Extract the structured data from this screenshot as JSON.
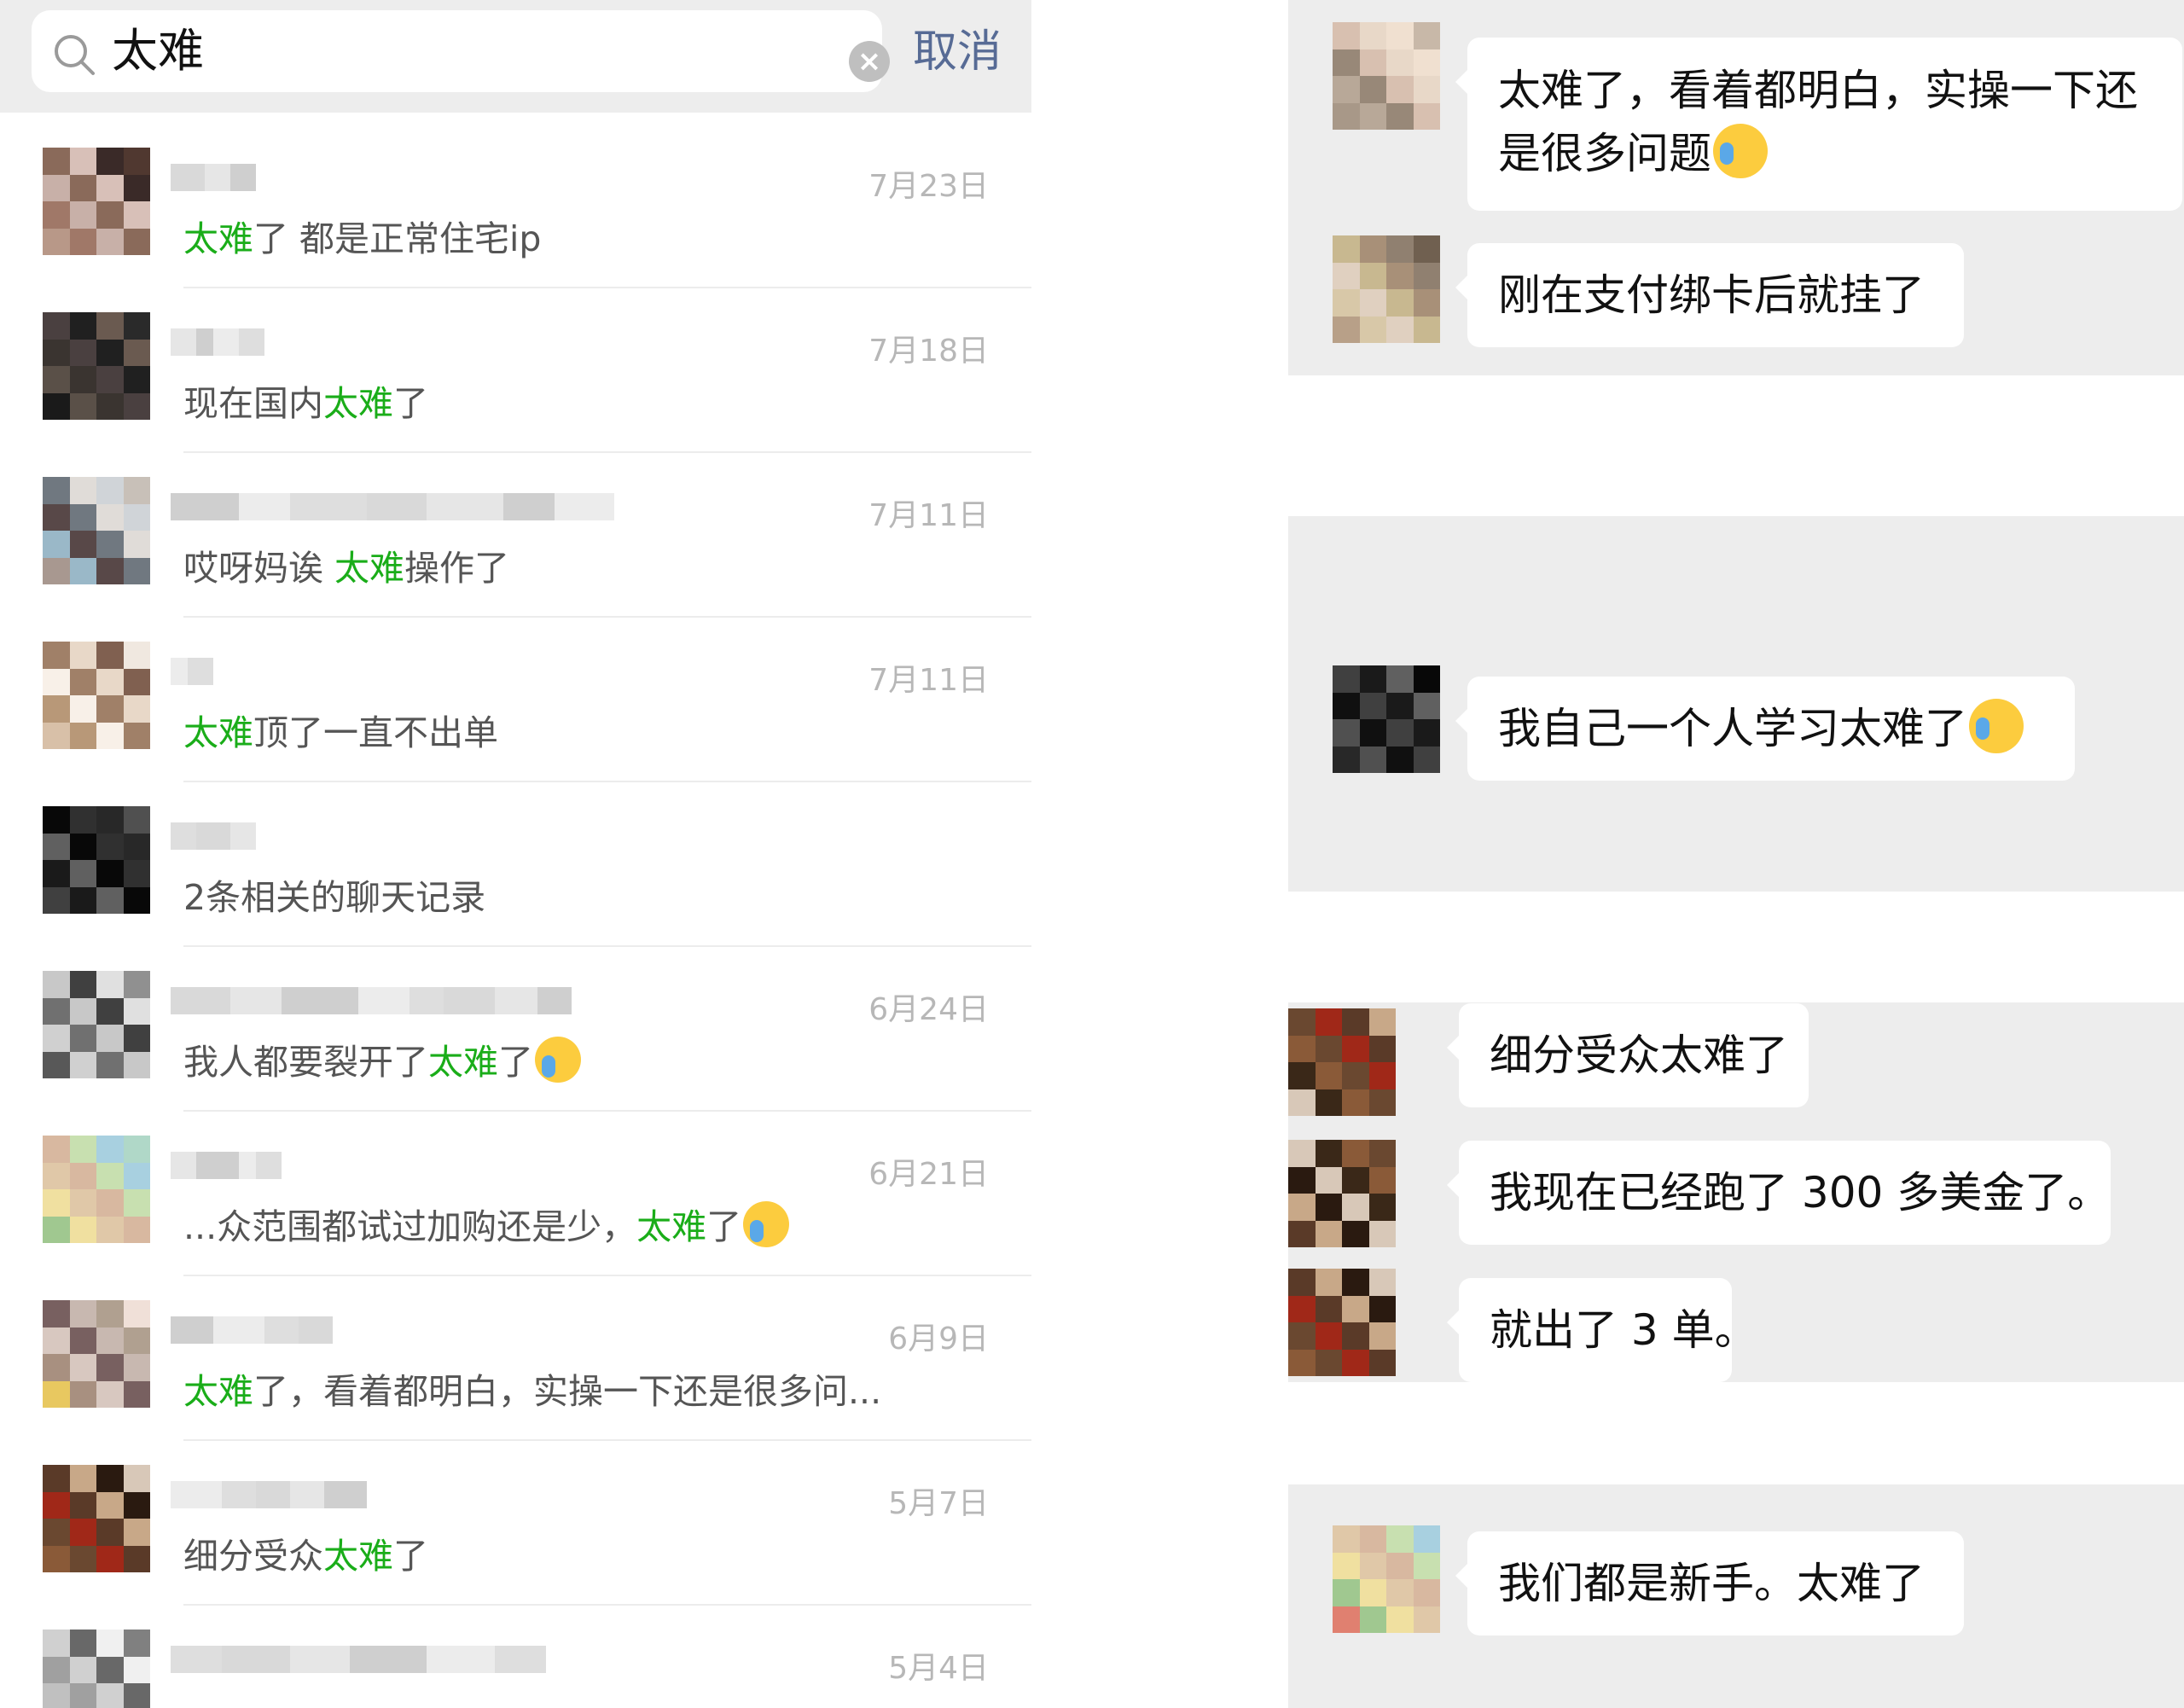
{
  "search": {
    "query": "太难",
    "cancel_label": "取消",
    "clear_icon": "×"
  },
  "results": [
    {
      "date": "7月23日",
      "pre": "",
      "hl": "太难",
      "post": "了 都是正常住宅ip",
      "emoji": false
    },
    {
      "date": "7月18日",
      "pre": "现在国内",
      "hl": "太难",
      "post": "了",
      "emoji": false
    },
    {
      "date": "7月11日",
      "pre": "哎呀妈诶 ",
      "hl": "太难",
      "post": "操作了",
      "emoji": false
    },
    {
      "date": "7月11日",
      "pre": "",
      "hl": "太难",
      "post": "顶了一直不出单",
      "emoji": false
    },
    {
      "date": "",
      "pre": "2条相关的聊天记录",
      "hl": "",
      "post": "",
      "emoji": false
    },
    {
      "date": "6月24日",
      "pre": "我人都要裂开了",
      "hl": "太难",
      "post": "了",
      "emoji": true
    },
    {
      "date": "6月21日",
      "pre": "...众范围都试过加购还是少，",
      "hl": "太难",
      "post": "了",
      "emoji": true
    },
    {
      "date": "6月9日",
      "pre": "",
      "hl": "太难",
      "post": "了，看着都明白，实操一下还是很多问...",
      "emoji": false
    },
    {
      "date": "5月7日",
      "pre": "细分受众",
      "hl": "太难",
      "post": "了",
      "emoji": false
    },
    {
      "date": "5月4日",
      "pre": "",
      "hl": "",
      "post": "",
      "emoji": false
    }
  ],
  "chat": {
    "messages": [
      {
        "line1": "太难了，看着都明白，实操一下还",
        "line2": "是很多问题"
      },
      {
        "line1": "刚在支付绑卡后就挂了"
      },
      {
        "line1": "我自己一个人学习太难了"
      },
      {
        "line1": "细分受众太难了"
      },
      {
        "line1": "我现在已经跑了 300 多美金了。"
      },
      {
        "line1": "就出了 3 单。"
      },
      {
        "line1": "我们都是新手。太难了"
      }
    ]
  },
  "colors": {
    "highlight": "#1aad19",
    "link": "#576b95",
    "date": "#b7b7b7",
    "chat_bg": "#ededed"
  },
  "icons": {
    "search": "search-icon",
    "clear": "clear-icon",
    "emoji": "crying-face-emoji"
  }
}
